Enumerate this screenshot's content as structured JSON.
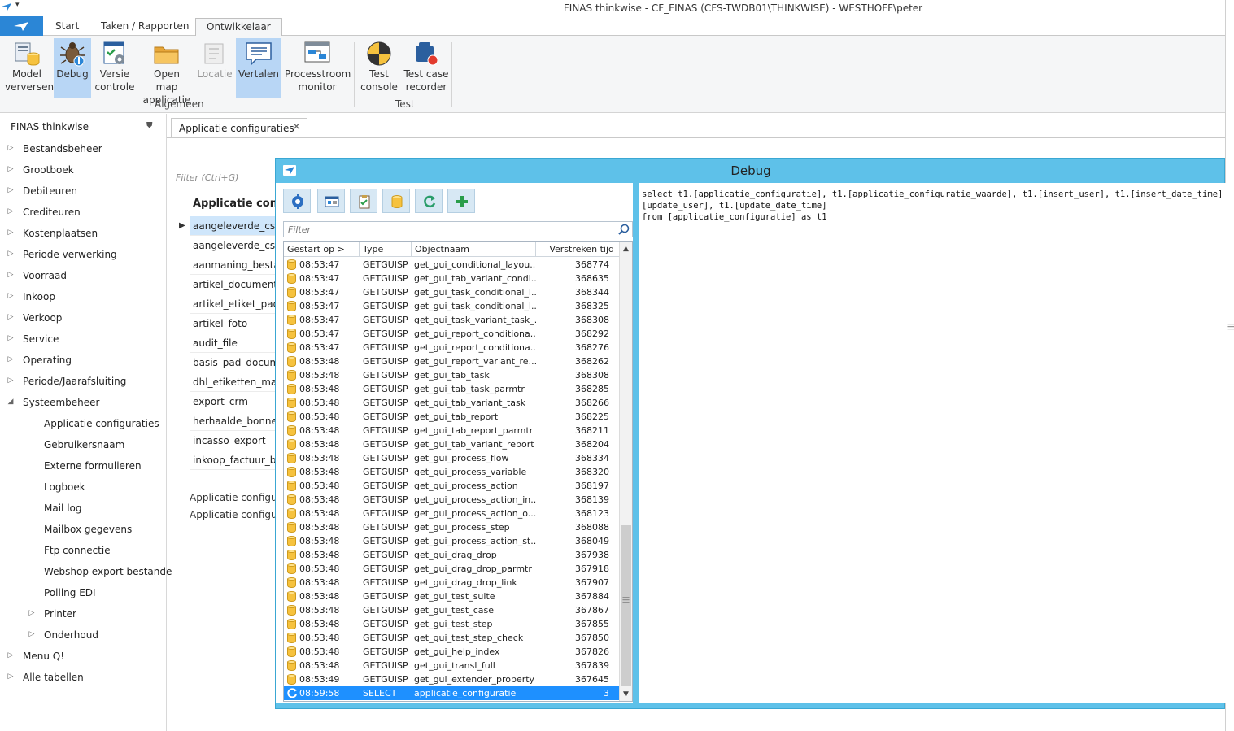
{
  "window": {
    "title": "FINAS thinkwise - CF_FINAS (CFS-TWDB01\\THINKWISE) - WESTHOFF\\peter"
  },
  "ribbon": {
    "tabs": [
      "Start",
      "Taken / Rapporten",
      "Ontwikkelaar"
    ],
    "active_tab": "Ontwikkelaar",
    "buttons": [
      {
        "label": "Model\nverversen",
        "icon": "model-refresh-icon",
        "active": false,
        "enabled": true
      },
      {
        "label": "Debug",
        "icon": "bug-icon",
        "active": true,
        "enabled": true
      },
      {
        "label": "Versie\ncontrole",
        "icon": "version-control-icon",
        "active": false,
        "enabled": true
      },
      {
        "label": "Open map\napplicatie",
        "icon": "folder-icon",
        "active": false,
        "enabled": true
      },
      {
        "label": "Locatie",
        "icon": "location-icon",
        "active": false,
        "enabled": false
      },
      {
        "label": "Vertalen",
        "icon": "translate-icon",
        "active": true,
        "enabled": true
      },
      {
        "label": "Processtroom\nmonitor",
        "icon": "process-monitor-icon",
        "active": false,
        "enabled": true
      },
      {
        "label": "Test\nconsole",
        "icon": "test-console-icon",
        "active": false,
        "enabled": true
      },
      {
        "label": "Test case\nrecorder",
        "icon": "test-recorder-icon",
        "active": false,
        "enabled": true
      }
    ],
    "groups": [
      "Algemeen",
      "Test"
    ]
  },
  "nav": {
    "title": "FINAS thinkwise",
    "items": [
      {
        "label": "Bestandsbeheer",
        "level": 0,
        "expandable": true,
        "expanded": false
      },
      {
        "label": "Grootboek",
        "level": 0,
        "expandable": true,
        "expanded": false
      },
      {
        "label": "Debiteuren",
        "level": 0,
        "expandable": true,
        "expanded": false
      },
      {
        "label": "Crediteuren",
        "level": 0,
        "expandable": true,
        "expanded": false
      },
      {
        "label": "Kostenplaatsen",
        "level": 0,
        "expandable": true,
        "expanded": false
      },
      {
        "label": "Periode verwerking",
        "level": 0,
        "expandable": true,
        "expanded": false
      },
      {
        "label": "Voorraad",
        "level": 0,
        "expandable": true,
        "expanded": false
      },
      {
        "label": "Inkoop",
        "level": 0,
        "expandable": true,
        "expanded": false
      },
      {
        "label": "Verkoop",
        "level": 0,
        "expandable": true,
        "expanded": false
      },
      {
        "label": "Service",
        "level": 0,
        "expandable": true,
        "expanded": false
      },
      {
        "label": "Operating",
        "level": 0,
        "expandable": true,
        "expanded": false
      },
      {
        "label": "Periode/Jaarafsluiting",
        "level": 0,
        "expandable": true,
        "expanded": false
      },
      {
        "label": "Systeembeheer",
        "level": 0,
        "expandable": true,
        "expanded": true
      },
      {
        "label": "Applicatie configuraties",
        "level": 1,
        "expandable": false,
        "expanded": false
      },
      {
        "label": "Gebruikersnaam",
        "level": 1,
        "expandable": false,
        "expanded": false
      },
      {
        "label": "Externe formulieren",
        "level": 1,
        "expandable": false,
        "expanded": false
      },
      {
        "label": "Logboek",
        "level": 1,
        "expandable": false,
        "expanded": false
      },
      {
        "label": "Mail log",
        "level": 1,
        "expandable": false,
        "expanded": false
      },
      {
        "label": "Mailbox gegevens",
        "level": 1,
        "expandable": false,
        "expanded": false
      },
      {
        "label": "Ftp connectie",
        "level": 1,
        "expandable": false,
        "expanded": false
      },
      {
        "label": "Webshop export bestande",
        "level": 1,
        "expandable": false,
        "expanded": false
      },
      {
        "label": "Polling EDI",
        "level": 1,
        "expandable": false,
        "expanded": false
      },
      {
        "label": "Printer",
        "level": 1,
        "expandable": true,
        "expanded": false
      },
      {
        "label": "Onderhoud",
        "level": 1,
        "expandable": true,
        "expanded": false
      },
      {
        "label": "Menu Q!",
        "level": 0,
        "expandable": true,
        "expanded": false
      },
      {
        "label": "Alle tabellen",
        "level": 0,
        "expandable": true,
        "expanded": false
      }
    ]
  },
  "document": {
    "tab_label": "Applicatie configuraties",
    "filter_placeholder": "Filter (Ctrl+G)",
    "grid_title": "Applicatie configuraties",
    "rows": [
      "aangeleverde_csv_bestand",
      "aangeleverde_csv_bestand",
      "aanmaning_bestand",
      "artikel_document",
      "artikel_etiket_pad",
      "artikel_foto",
      "audit_file",
      "basis_pad_documenten",
      "dhl_etiketten_map",
      "export_crm",
      "herhaalde_bonnen_",
      "incasso_export",
      "inkoop_factuur_bestand"
    ],
    "bottom_labels": [
      "Applicatie configuraties",
      "Applicatie configuraties"
    ]
  },
  "debug": {
    "title": "Debug",
    "toolbar_icons": [
      "settings-icon",
      "properties-icon",
      "checklist-icon",
      "database-icon",
      "refresh-icon",
      "add-icon"
    ],
    "filter_placeholder": "Filter",
    "columns": [
      "Gestart op >",
      "Type",
      "Objectnaam",
      "Verstreken tijd"
    ],
    "rows": [
      {
        "time": "08:53:47",
        "type": "GETGUISP",
        "object": "get_gui_conditional_layou...",
        "elapsed": "368774"
      },
      {
        "time": "08:53:47",
        "type": "GETGUISP",
        "object": "get_gui_tab_variant_condi...",
        "elapsed": "368635"
      },
      {
        "time": "08:53:47",
        "type": "GETGUISP",
        "object": "get_gui_task_conditional_l...",
        "elapsed": "368344"
      },
      {
        "time": "08:53:47",
        "type": "GETGUISP",
        "object": "get_gui_task_conditional_l...",
        "elapsed": "368325"
      },
      {
        "time": "08:53:47",
        "type": "GETGUISP",
        "object": "get_gui_task_variant_task_...",
        "elapsed": "368308"
      },
      {
        "time": "08:53:47",
        "type": "GETGUISP",
        "object": "get_gui_report_conditiona...",
        "elapsed": "368292"
      },
      {
        "time": "08:53:47",
        "type": "GETGUISP",
        "object": "get_gui_report_conditiona...",
        "elapsed": "368276"
      },
      {
        "time": "08:53:48",
        "type": "GETGUISP",
        "object": "get_gui_report_variant_re...",
        "elapsed": "368262"
      },
      {
        "time": "08:53:48",
        "type": "GETGUISP",
        "object": "get_gui_tab_task",
        "elapsed": "368308"
      },
      {
        "time": "08:53:48",
        "type": "GETGUISP",
        "object": "get_gui_tab_task_parmtr",
        "elapsed": "368285"
      },
      {
        "time": "08:53:48",
        "type": "GETGUISP",
        "object": "get_gui_tab_variant_task",
        "elapsed": "368266"
      },
      {
        "time": "08:53:48",
        "type": "GETGUISP",
        "object": "get_gui_tab_report",
        "elapsed": "368225"
      },
      {
        "time": "08:53:48",
        "type": "GETGUISP",
        "object": "get_gui_tab_report_parmtr",
        "elapsed": "368211"
      },
      {
        "time": "08:53:48",
        "type": "GETGUISP",
        "object": "get_gui_tab_variant_report",
        "elapsed": "368204"
      },
      {
        "time": "08:53:48",
        "type": "GETGUISP",
        "object": "get_gui_process_flow",
        "elapsed": "368334"
      },
      {
        "time": "08:53:48",
        "type": "GETGUISP",
        "object": "get_gui_process_variable",
        "elapsed": "368320"
      },
      {
        "time": "08:53:48",
        "type": "GETGUISP",
        "object": "get_gui_process_action",
        "elapsed": "368197"
      },
      {
        "time": "08:53:48",
        "type": "GETGUISP",
        "object": "get_gui_process_action_in...",
        "elapsed": "368139"
      },
      {
        "time": "08:53:48",
        "type": "GETGUISP",
        "object": "get_gui_process_action_o...",
        "elapsed": "368123"
      },
      {
        "time": "08:53:48",
        "type": "GETGUISP",
        "object": "get_gui_process_step",
        "elapsed": "368088"
      },
      {
        "time": "08:53:48",
        "type": "GETGUISP",
        "object": "get_gui_process_action_st...",
        "elapsed": "368049"
      },
      {
        "time": "08:53:48",
        "type": "GETGUISP",
        "object": "get_gui_drag_drop",
        "elapsed": "367938"
      },
      {
        "time": "08:53:48",
        "type": "GETGUISP",
        "object": "get_gui_drag_drop_parmtr",
        "elapsed": "367918"
      },
      {
        "time": "08:53:48",
        "type": "GETGUISP",
        "object": "get_gui_drag_drop_link",
        "elapsed": "367907"
      },
      {
        "time": "08:53:48",
        "type": "GETGUISP",
        "object": "get_gui_test_suite",
        "elapsed": "367884"
      },
      {
        "time": "08:53:48",
        "type": "GETGUISP",
        "object": "get_gui_test_case",
        "elapsed": "367867"
      },
      {
        "time": "08:53:48",
        "type": "GETGUISP",
        "object": "get_gui_test_step",
        "elapsed": "367855"
      },
      {
        "time": "08:53:48",
        "type": "GETGUISP",
        "object": "get_gui_test_step_check",
        "elapsed": "367850"
      },
      {
        "time": "08:53:48",
        "type": "GETGUISP",
        "object": "get_gui_help_index",
        "elapsed": "367826"
      },
      {
        "time": "08:53:48",
        "type": "GETGUISP",
        "object": "get_gui_transl_full",
        "elapsed": "367839"
      },
      {
        "time": "08:53:49",
        "type": "GETGUISP",
        "object": "get_gui_extender_property",
        "elapsed": "367645"
      },
      {
        "time": "08:59:58",
        "type": "SELECT",
        "object": "applicatie_configuratie",
        "elapsed": "3",
        "selected": true
      }
    ],
    "sql_lines": [
      "select t1.[applicatie_configuratie], t1.[applicatie_configuratie_waarde], t1.[insert_user], t1.[insert_date_time],",
      "[update_user], t1.[update_date_time]",
      "from [applicatie_configuratie] as t1"
    ]
  },
  "colors": {
    "accent": "#2b86d6",
    "debug_frame": "#5ec1e9",
    "selection": "#1e90ff",
    "ribbon_active": "#b8d6f5"
  }
}
